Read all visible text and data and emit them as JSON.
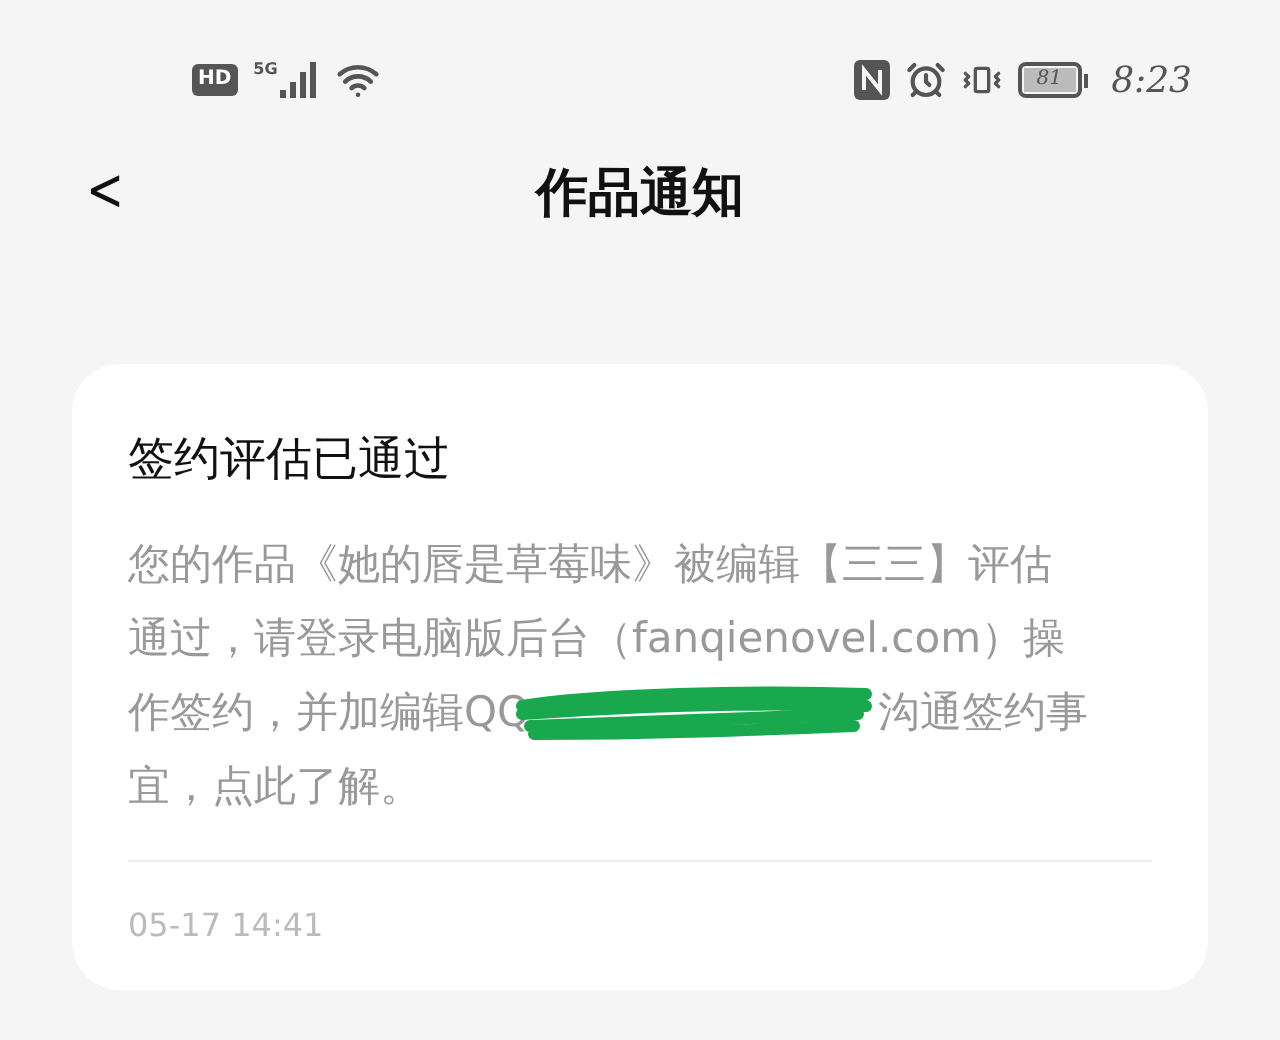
{
  "status_bar": {
    "hd": "HD",
    "network": "5G",
    "battery": "81",
    "time": "8:23"
  },
  "header": {
    "back": "<",
    "title": "作品通知"
  },
  "notification": {
    "title": "签约评估已通过",
    "message_lines": [
      [
        {
          "kind": "text",
          "text": "您的作品《她的唇是草莓味》被编辑【三三】评估"
        }
      ],
      [
        {
          "kind": "text",
          "text": "通过，请登录电脑版后台（fanqienovel.com）操"
        }
      ],
      [
        {
          "kind": "text",
          "text": "作签约，并加编辑QQ"
        },
        {
          "kind": "redaction"
        },
        {
          "kind": "text",
          "text": "沟通签约事"
        }
      ],
      [
        {
          "kind": "text",
          "text": "宜，点此了解。"
        }
      ]
    ],
    "time": "05-17 14:41"
  }
}
